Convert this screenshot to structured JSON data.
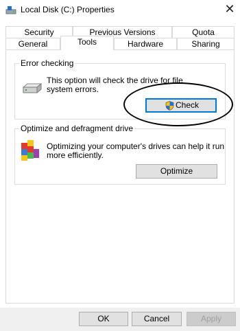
{
  "window": {
    "title": "Local Disk (C:) Properties",
    "icon": "drive-icon",
    "close_glyph": "✕"
  },
  "tabs": {
    "row1": [
      "Security",
      "Previous Versions",
      "Quota"
    ],
    "row2": [
      "General",
      "Tools",
      "Hardware",
      "Sharing"
    ],
    "active": "Tools"
  },
  "error_checking": {
    "label": "Error checking",
    "description_line1": "This option will check the drive for file",
    "description_line2": "system errors.",
    "button": "Check",
    "icon": "hard-drive-icon"
  },
  "optimize": {
    "label": "Optimize and defragment drive",
    "description_line1": "Optimizing your computer's drives can help it run",
    "description_line2": "more efficiently.",
    "button": "Optimize",
    "icon": "defrag-icon"
  },
  "footer": {
    "ok": "OK",
    "cancel": "Cancel",
    "apply": "Apply"
  },
  "colors": {
    "focus_border": "#0078d7",
    "button_face": "#e1e1e1",
    "annotation": "#000000"
  }
}
